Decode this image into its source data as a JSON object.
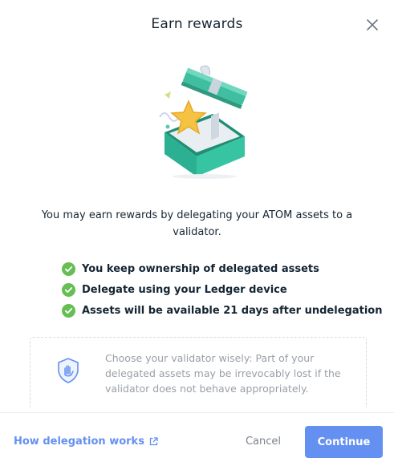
{
  "modal": {
    "title": "Earn rewards",
    "description": "You may earn rewards by delegating your ATOM assets to a validator.",
    "features": [
      "You keep ownership of delegated assets",
      "Delegate using your Ledger device",
      "Assets will be available 21 days after undelegation"
    ],
    "warning": "Choose your validator wisely: Part of your delegated assets may be irrevocably lost if the validator does not behave appropriately."
  },
  "footer": {
    "help_link": "How delegation works",
    "cancel_label": "Cancel",
    "continue_label": "Continue"
  },
  "icons": {
    "close": "close-icon",
    "check": "check-circle-icon",
    "shield": "shield-hand-icon",
    "external": "external-link-icon",
    "illustration": "gift-box-illustration"
  },
  "colors": {
    "accent": "#6490f1",
    "success": "#66be54",
    "text": "#142533",
    "muted": "#999fa8"
  }
}
